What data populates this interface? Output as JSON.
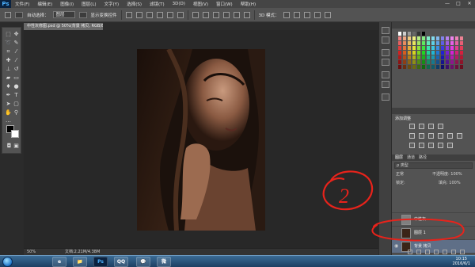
{
  "app": {
    "logo": "Ps"
  },
  "menu": [
    "文件(F)",
    "编辑(E)",
    "图像(I)",
    "图层(L)",
    "文字(Y)",
    "选择(S)",
    "滤镜(T)",
    "3D(D)",
    "视图(V)",
    "窗口(W)",
    "帮助(H)"
  ],
  "window_controls": {
    "min": "—",
    "max": "□",
    "close": "✕"
  },
  "options_bar": {
    "auto_select_label": "自动选择：",
    "auto_select_value": "图层",
    "show_transform_label": "显示变换控件",
    "3d_mode_label": "3D 模式："
  },
  "document": {
    "tab_title": "中性灰修图.psd @ 50%(背景 拷贝, RGB/8) *",
    "zoom": "50%",
    "doc_info": "文档:2.21M/4.38M"
  },
  "panels": {
    "adjustments_title": "添加调整",
    "layers_tabs": [
      "图层",
      "通道",
      "路径"
    ],
    "filter_label": "ρ 类型",
    "blend_mode": "正常",
    "opacity_label": "不透明度: 100%",
    "lock_label": "锁定:",
    "fill_label": "填充: 100%"
  },
  "layers": [
    {
      "name": "中性灰",
      "visible": false,
      "selected": false,
      "thumb": "#7f7f7f"
    },
    {
      "name": "图层 1",
      "visible": false,
      "selected": false,
      "thumb": "#3a2418"
    },
    {
      "name": "背景 拷贝",
      "visible": true,
      "selected": true,
      "thumb": "#3a2418"
    },
    {
      "name": "背景",
      "visible": true,
      "selected": false,
      "thumb": "#3a2418"
    }
  ],
  "taskbar": {
    "apps": [
      "e",
      "📁",
      "Ps",
      "QQ",
      "💬",
      "微"
    ],
    "clock_time": "10:15",
    "clock_date": "2016/6/1"
  },
  "annotation": {
    "number": "2",
    "color": "#e8231b"
  },
  "colors": {
    "accent": "#4cb2ff",
    "selection": "#5f6f87"
  }
}
